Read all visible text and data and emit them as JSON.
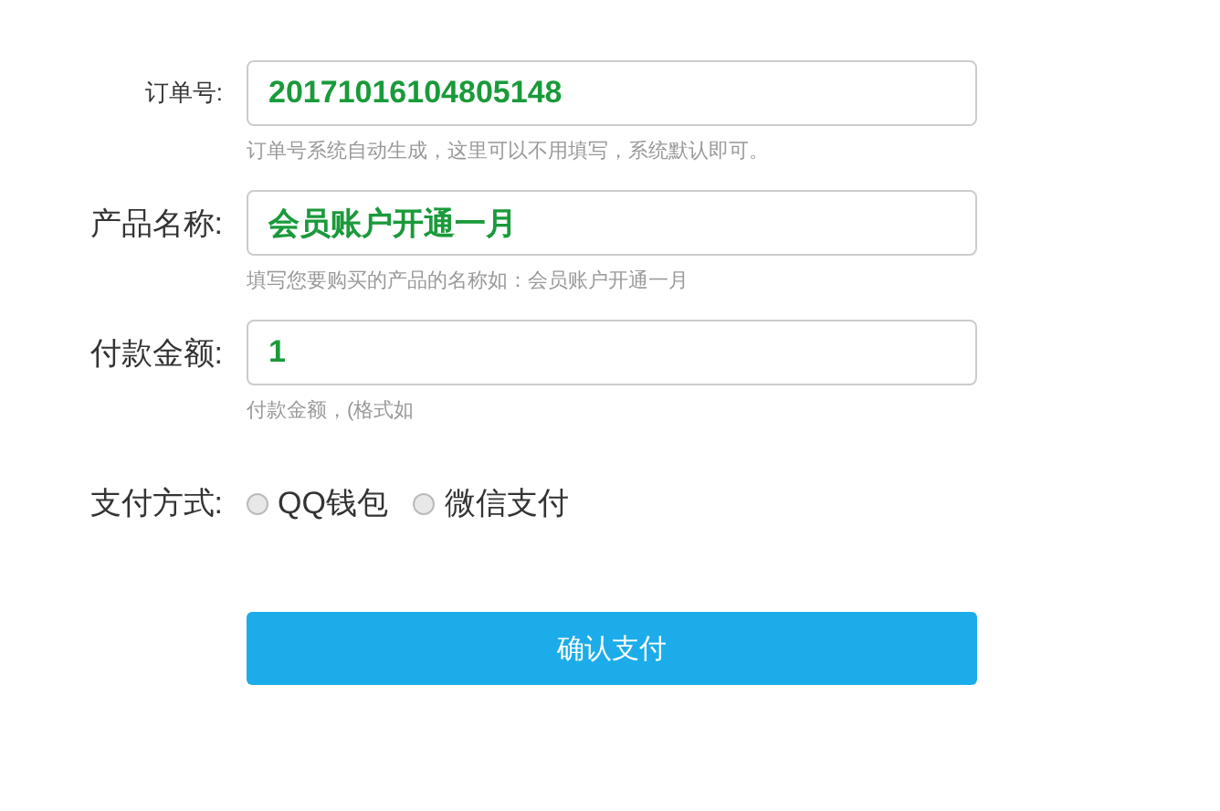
{
  "fields": [
    {
      "label": "订单号:",
      "value": "20171016104805148",
      "hint": "订单号系统自动生成，这里可以不用填写，系统默认即可。",
      "small_label": true
    },
    {
      "label": "产品名称:",
      "value": "会员账户开通一月",
      "hint": "填写您要购买的产品的名称如：会员账户开通一月",
      "small_label": false
    },
    {
      "label": "付款金额:",
      "value": "1",
      "hint": "付款金额，(格式如",
      "small_label": false
    }
  ],
  "payment": {
    "label": "支付方式:",
    "options": [
      {
        "label": "QQ钱包",
        "selected": false
      },
      {
        "label": "微信支付",
        "selected": false
      }
    ]
  },
  "submit": "确认支付"
}
